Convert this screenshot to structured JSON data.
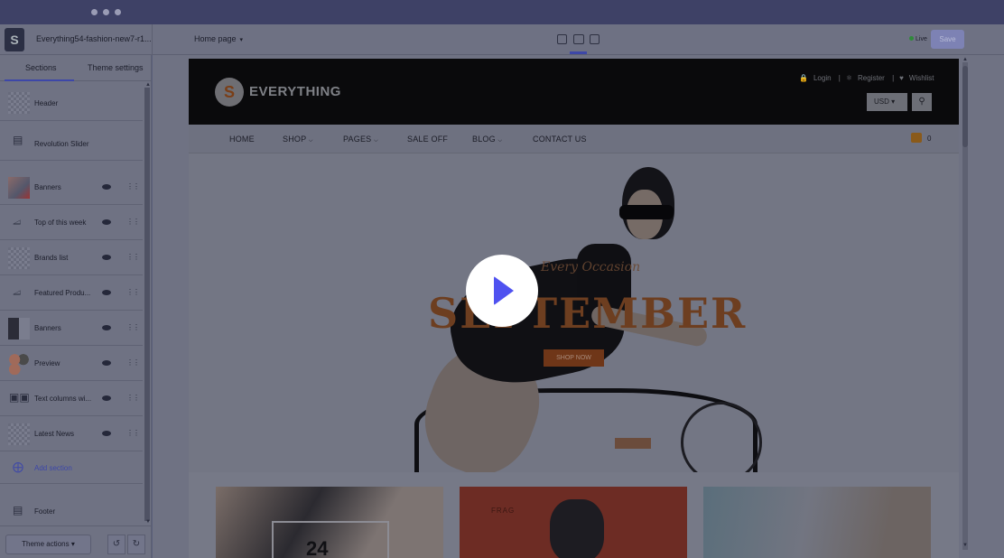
{
  "topbar": {
    "theme_name": "Everything54-fashion-new7-r1...",
    "page_select": "Home page",
    "status": "Live",
    "save_label": "Save"
  },
  "sidebar": {
    "tabs": [
      "Sections",
      "Theme settings"
    ],
    "sections": [
      {
        "label": "Header",
        "thumb": "placeholder",
        "icon": "",
        "eye": false
      },
      {
        "label": "Revolution Slider",
        "thumb": "",
        "icon": "slider-icon",
        "eye": false
      },
      {
        "label": "Banners",
        "thumb": "image",
        "icon": "",
        "eye": true
      },
      {
        "label": "Top of this week",
        "thumb": "",
        "icon": "tag-icon",
        "eye": true
      },
      {
        "label": "Brands list",
        "thumb": "placeholder",
        "icon": "",
        "eye": true
      },
      {
        "label": "Featured Produ...",
        "thumb": "",
        "icon": "tag-icon",
        "eye": true
      },
      {
        "label": "Banners",
        "thumb": "image",
        "icon": "",
        "eye": true
      },
      {
        "label": "Preview",
        "thumb": "image",
        "icon": "",
        "eye": true
      },
      {
        "label": "Text columns wi...",
        "thumb": "",
        "icon": "text-columns-icon",
        "eye": true
      },
      {
        "label": "Latest News",
        "thumb": "image",
        "icon": "",
        "eye": true
      }
    ],
    "add_section": "Add section",
    "footer_label": "Footer",
    "theme_actions": "Theme actions"
  },
  "store": {
    "brand_letter": "S",
    "brand_name": "EVERYTHING",
    "header_links": [
      "Login",
      "Register",
      "Wishlist"
    ],
    "currency": "USD",
    "nav": [
      "HOME",
      "SHOP",
      "PAGES",
      "SALE OFF",
      "BLOG",
      "CONTACT US"
    ],
    "cart_count": "0",
    "hero": {
      "script_text": "Every Occasion",
      "title": "SEPTEMBER",
      "cta": "SHOP NOW"
    },
    "banner_text": "24",
    "banner2_text": "FRAG"
  },
  "colors": {
    "accent": "#3d47a8",
    "play_button": "#4f52f0",
    "overlay": "#5b5f7a"
  }
}
